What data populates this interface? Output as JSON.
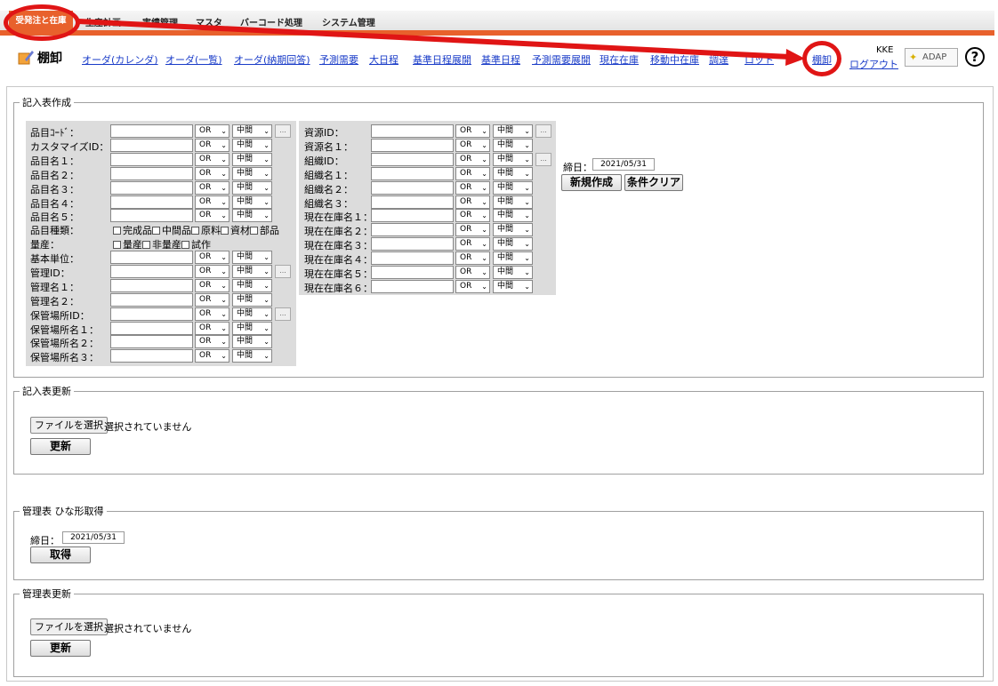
{
  "topnav": {
    "items": [
      "受発注と在庫",
      "生産計画",
      "実績管理",
      "マスタ",
      "バーコード処理",
      "システム管理"
    ],
    "active_color": "#e8612c"
  },
  "header": {
    "title": "棚卸",
    "links": [
      "オーダ(カレンダ)",
      "オーダ(一覧)",
      "オーダ(納期回答)",
      "予測需要",
      "大日程",
      "基準日程展開",
      "基準日程",
      "予測需要展開",
      "現在在庫",
      "移動中在庫",
      "調達",
      "ロット",
      "棚卸"
    ],
    "user": "KKE",
    "logout": "ログアウト",
    "logo": "ADAP",
    "help": "?"
  },
  "create": {
    "legend": "記入表作成",
    "left_rows": [
      {
        "label": "品目ｺｰﾄﾞ：",
        "dots": true
      },
      {
        "label": "カスタマイズID：",
        "dots": false
      },
      {
        "label": "品目名１：",
        "dots": false
      },
      {
        "label": "品目名２：",
        "dots": false
      },
      {
        "label": "品目名３：",
        "dots": false
      },
      {
        "label": "品目名４：",
        "dots": false
      },
      {
        "label": "品目名５：",
        "dots": false
      }
    ],
    "kind_label": "品目種類：",
    "kind_options": [
      "完成品",
      "中間品",
      "原料",
      "資材",
      "部品"
    ],
    "mass_label": "量産：",
    "mass_options": [
      "量産",
      "非量産",
      "試作"
    ],
    "left_rows2": [
      {
        "label": "基本単位：",
        "dots": false
      },
      {
        "label": "管理ID：",
        "dots": true
      },
      {
        "label": "管理名１：",
        "dots": false
      },
      {
        "label": "管理名２：",
        "dots": false
      },
      {
        "label": "保管場所ID：",
        "dots": true
      },
      {
        "label": "保管場所名１：",
        "dots": false
      },
      {
        "label": "保管場所名２：",
        "dots": false
      },
      {
        "label": "保管場所名３：",
        "dots": false
      }
    ],
    "right_rows": [
      {
        "label": "資源ID：",
        "dots": true
      },
      {
        "label": "資源名１：",
        "dots": false
      },
      {
        "label": "組織ID：",
        "dots": true
      },
      {
        "label": "組織名１：",
        "dots": false
      },
      {
        "label": "組織名２：",
        "dots": false
      },
      {
        "label": "組織名３：",
        "dots": false
      },
      {
        "label": "現在在庫名１：",
        "dots": false
      },
      {
        "label": "現在在庫名２：",
        "dots": false
      },
      {
        "label": "現在在庫名３：",
        "dots": false
      },
      {
        "label": "現在在庫名４：",
        "dots": false
      },
      {
        "label": "現在在庫名５：",
        "dots": false
      },
      {
        "label": "現在在庫名６：",
        "dots": false
      }
    ],
    "op_value": "OR",
    "match_value": "中間",
    "dots_label": "...",
    "close_label": "締日：",
    "close_date": "2021/05/31",
    "new_button": "新規作成",
    "clear_button": "条件クリア"
  },
  "update": {
    "legend": "記入表更新",
    "file_button": "ファイルを選択",
    "file_status": "選択されていません",
    "button": "更新"
  },
  "template": {
    "legend": "管理表 ひな形取得",
    "close_label": "締日：",
    "close_date": "2021/05/31",
    "button": "取得"
  },
  "mgmt_update": {
    "legend": "管理表更新",
    "file_button": "ファイルを選択",
    "file_status": "選択されていません",
    "button": "更新"
  }
}
